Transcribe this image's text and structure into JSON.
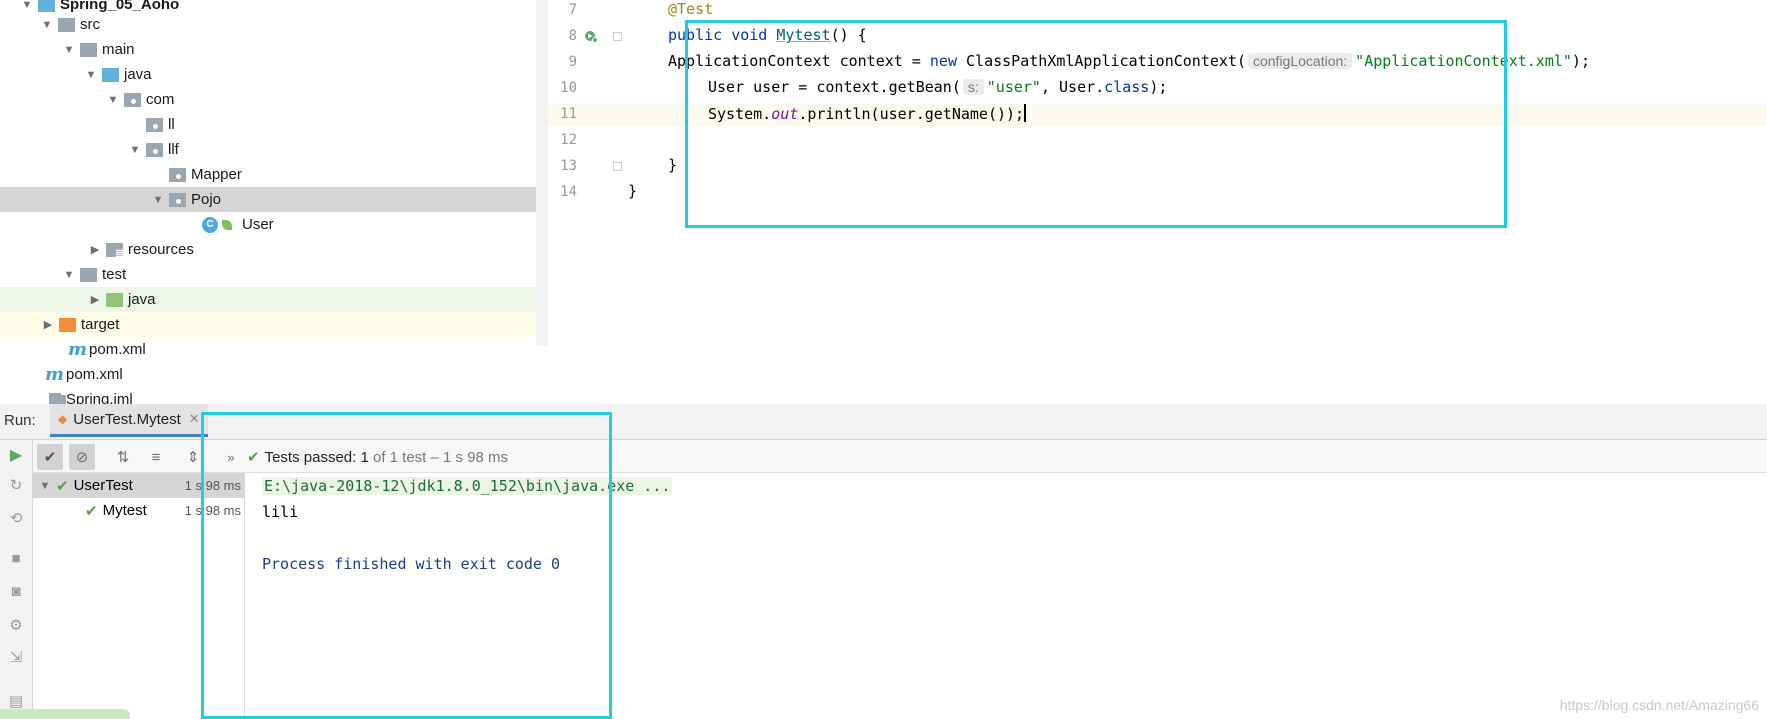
{
  "project_tree": {
    "items": [
      {
        "label": "Spring_05_Aoho",
        "icon": "module-icon",
        "expanded": true
      },
      {
        "label": "src",
        "icon": "folder-icon",
        "expanded": true
      },
      {
        "label": "main",
        "icon": "folder-icon",
        "expanded": true
      },
      {
        "label": "java",
        "icon": "source-root-icon",
        "expanded": true
      },
      {
        "label": "com",
        "icon": "package-icon",
        "expanded": true
      },
      {
        "label": "ll",
        "icon": "package-icon"
      },
      {
        "label": "llf",
        "icon": "package-icon",
        "expanded": true
      },
      {
        "label": "Mapper",
        "icon": "package-icon"
      },
      {
        "label": "Pojo",
        "icon": "package-icon",
        "expanded": true,
        "selected": true
      },
      {
        "label": "User",
        "icon": "class-icon"
      },
      {
        "label": "resources",
        "icon": "resources-folder-icon",
        "expanded": false
      },
      {
        "label": "test",
        "icon": "folder-icon",
        "expanded": true
      },
      {
        "label": "java",
        "icon": "test-root-icon",
        "expanded": false
      },
      {
        "label": "target",
        "icon": "excluded-folder-icon",
        "expanded": false
      },
      {
        "label": "pom.xml",
        "icon": "maven-icon"
      },
      {
        "label": "pom.xml",
        "icon": "maven-icon"
      },
      {
        "label": "Spring.iml",
        "icon": "iml-icon"
      }
    ]
  },
  "editor": {
    "lines": [
      {
        "num": "7",
        "text": "@Test"
      },
      {
        "num": "8",
        "text": "public void Mytest() {"
      },
      {
        "num": "9",
        "text": "ApplicationContext context = new ClassPathXmlApplicationContext( configLocation: \"ApplicationContext.xml\");"
      },
      {
        "num": "10",
        "text": "User user = context.getBean( s: \"user\", User.class);"
      },
      {
        "num": "11",
        "text": "System.out.println(user.getName());"
      },
      {
        "num": "12",
        "text": ""
      },
      {
        "num": "13",
        "text": "}"
      },
      {
        "num": "14",
        "text": "}"
      }
    ],
    "tokens": {
      "annotation": "@Test",
      "kw_public": "public",
      "kw_void": "void",
      "method_name": "Mytest",
      "sig_rest": "() {",
      "l9_a": "ApplicationContext context = ",
      "kw_new": "new",
      "l9_b": " ClassPathXmlApplicationContext(",
      "hint_config": "configLocation:",
      "str_xml": "\"ApplicationContext.xml\"",
      "l9_c": ");",
      "l10_a": "User user = context.getBean(",
      "hint_s": "s:",
      "str_user": "\"user\"",
      "l10_b": ", User.",
      "kw_class": "class",
      "l10_c": ");",
      "l11_a": "System.",
      "fld_out": "out",
      "l11_b": ".println(user.getName());",
      "brace_method": "}",
      "brace_class": "}"
    }
  },
  "run_window": {
    "label": "Run:",
    "tab_label": "UserTest.Mytest",
    "status": {
      "prefix": "Tests passed: ",
      "passed": "1",
      "rest": " of 1 test – 1 s 98 ms"
    },
    "test_tree": [
      {
        "label": "UserTest",
        "duration": "1 s 98 ms",
        "status": "passed"
      },
      {
        "label": "Mytest",
        "duration": "1 s 98 ms",
        "status": "passed"
      }
    ],
    "console": [
      "E:\\java-2018-12\\jdk1.8.0_152\\bin\\java.exe ...",
      "lili",
      "",
      "Process finished with exit code 0"
    ]
  },
  "colors": {
    "highlight_box": "#23cdde",
    "passed": "#5a9e3c",
    "keyword": "#0033b3",
    "string": "#067d17"
  },
  "watermark": "https://blog.csdn.net/Amazing66"
}
